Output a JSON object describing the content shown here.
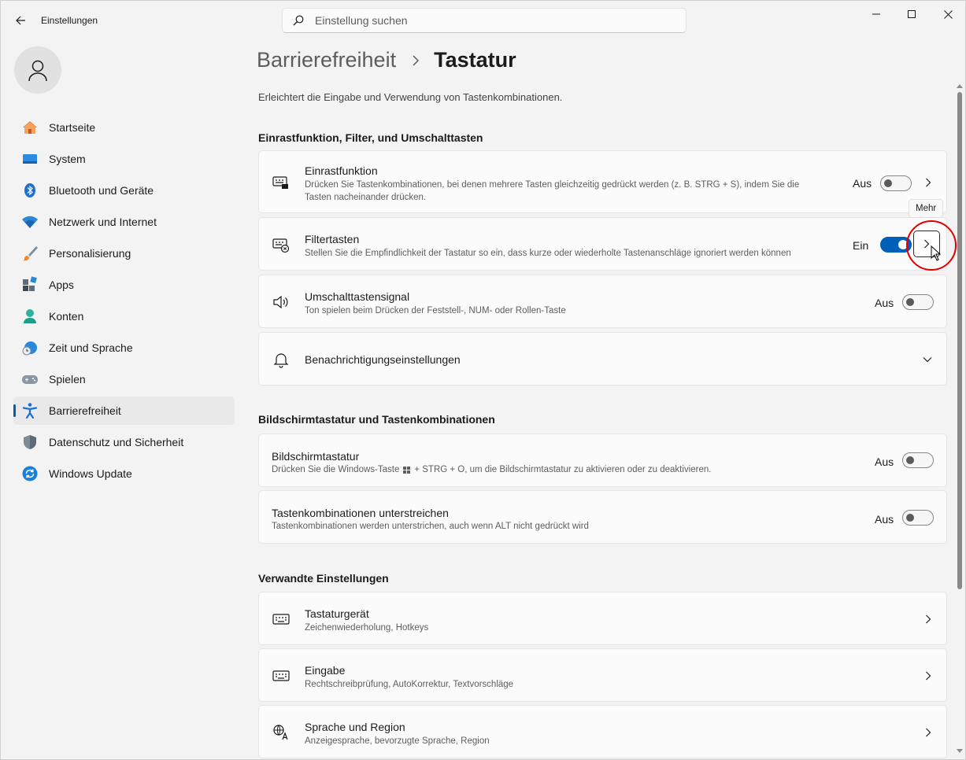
{
  "app": {
    "title": "Einstellungen"
  },
  "search": {
    "placeholder": "Einstellung suchen"
  },
  "sidebar": {
    "items": [
      {
        "label": "Startseite",
        "icon": "home-icon"
      },
      {
        "label": "System",
        "icon": "system-icon"
      },
      {
        "label": "Bluetooth und Geräte",
        "icon": "bluetooth-icon"
      },
      {
        "label": "Netzwerk und Internet",
        "icon": "wifi-icon"
      },
      {
        "label": "Personalisierung",
        "icon": "brush-icon"
      },
      {
        "label": "Apps",
        "icon": "apps-icon"
      },
      {
        "label": "Konten",
        "icon": "account-icon"
      },
      {
        "label": "Zeit und Sprache",
        "icon": "clock-globe-icon"
      },
      {
        "label": "Spielen",
        "icon": "gamepad-icon"
      },
      {
        "label": "Barrierefreiheit",
        "icon": "accessibility-icon",
        "active": true
      },
      {
        "label": "Datenschutz und Sicherheit",
        "icon": "shield-icon"
      },
      {
        "label": "Windows Update",
        "icon": "update-icon"
      }
    ]
  },
  "breadcrumb": {
    "parent": "Barrierefreiheit",
    "current": "Tastatur"
  },
  "intro": "Erleichtert die Eingabe und Verwendung von Tastenkombinationen.",
  "sections": {
    "s1": "Einrastfunktion, Filter, und Umschalttasten",
    "s2": "Bildschirmtastatur und Tastenkombinationen",
    "s3": "Verwandte Einstellungen"
  },
  "cards": {
    "sticky": {
      "title": "Einrastfunktion",
      "desc1": "Drücken Sie Tastenkombinationen, bei denen mehrere Tasten gleichzeitig gedrückt werden (z. B. STRG + S), indem Sie die",
      "desc2": "Tasten nacheinander drücken.",
      "state": "Aus"
    },
    "filter": {
      "title": "Filtertasten",
      "desc": "Stellen Sie die Empfindlichkeit der Tastatur so ein, dass kurze oder wiederholte Tastenanschläge ignoriert werden können",
      "state": "Ein"
    },
    "toggle": {
      "title": "Umschalttastensignal",
      "desc": "Ton spielen beim Drücken der Feststell-, NUM- oder Rollen-Taste",
      "state": "Aus"
    },
    "notify": {
      "title": "Benachrichtigungseinstellungen"
    },
    "osk": {
      "title": "Bildschirmtastatur",
      "desc_a": "Drücken Sie die Windows-Taste",
      "desc_b": "+ STRG + O, um die Bildschirmtastatur zu aktivieren oder zu deaktivieren.",
      "state": "Aus"
    },
    "underline": {
      "title": "Tastenkombinationen unterstreichen",
      "desc": "Tastenkombinationen werden unterstrichen, auch wenn ALT nicht gedrückt wird",
      "state": "Aus"
    },
    "device": {
      "title": "Tastaturgerät",
      "desc": "Zeichenwiederholung, Hotkeys"
    },
    "input": {
      "title": "Eingabe",
      "desc": "Rechtschreibprüfung, AutoKorrektur, Textvorschläge"
    },
    "lang": {
      "title": "Sprache und Region",
      "desc": "Anzeigesprache, bevorzugte Sprache, Region"
    }
  },
  "tooltip": "Mehr",
  "colors": {
    "accent": "#005fb8",
    "highlight": "#e00000"
  }
}
